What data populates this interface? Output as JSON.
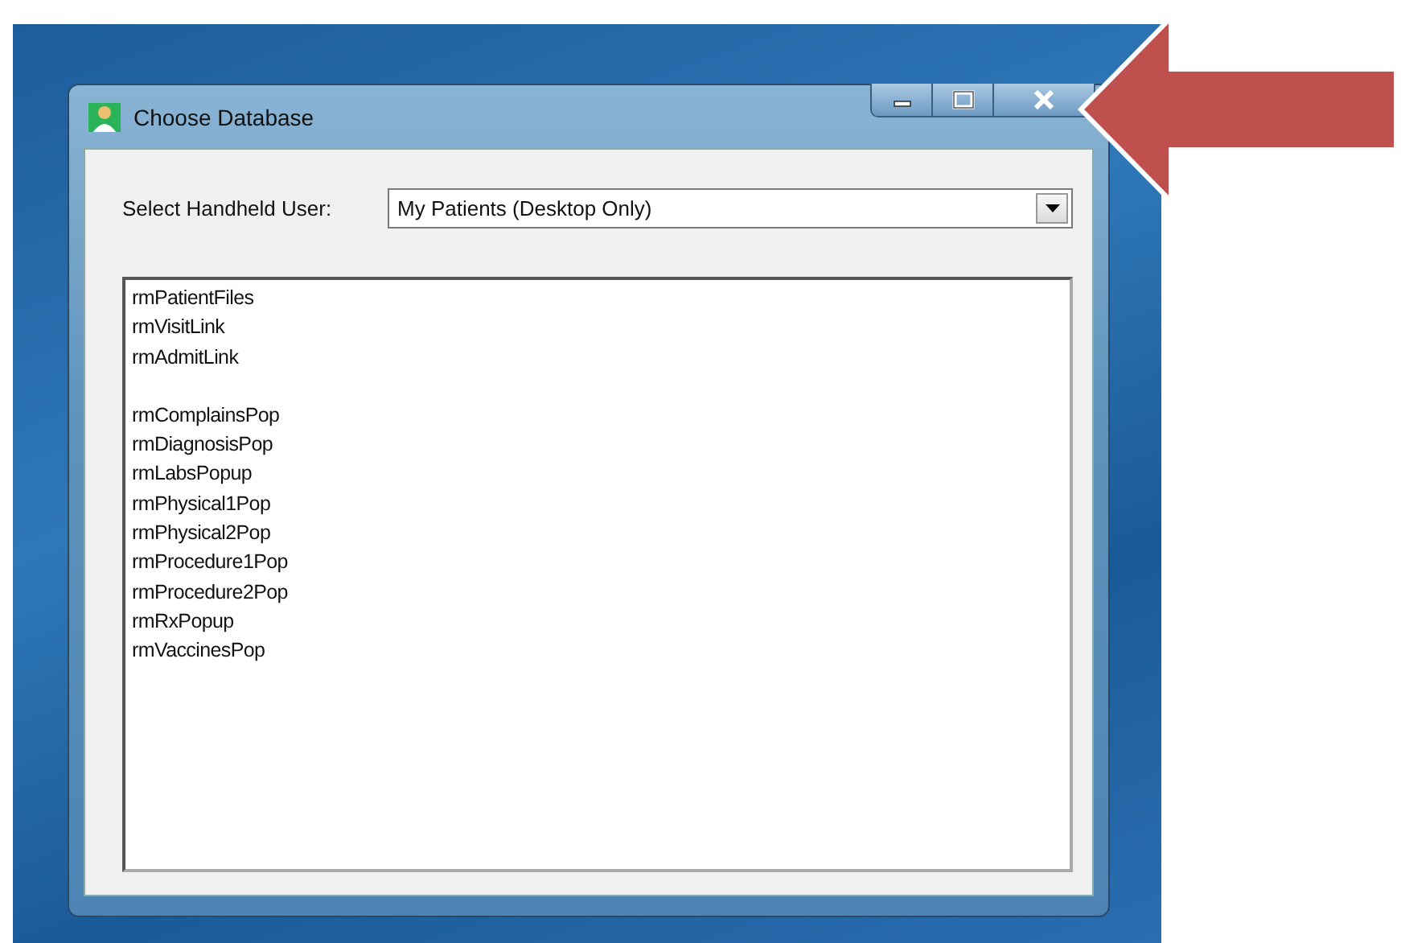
{
  "window": {
    "title": "Choose Database"
  },
  "user_select": {
    "label": "Select Handheld User:",
    "value": "My Patients (Desktop Only)"
  },
  "database_list": {
    "groups": [
      [
        "rmPatientFiles",
        "rmVisitLink",
        "rmAdmitLink"
      ],
      [
        "rmComplainsPop",
        "rmDiagnosisPop",
        "rmLabsPopup",
        "rmPhysical1Pop",
        "rmPhysical2Pop",
        "rmProcedure1Pop",
        "rmProcedure2Pop",
        "rmRxPopup",
        "rmVaccinesPop"
      ]
    ]
  }
}
